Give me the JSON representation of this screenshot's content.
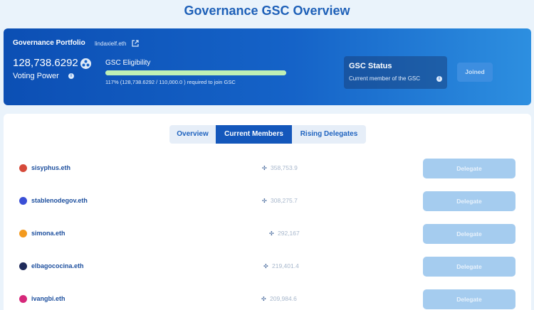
{
  "page": {
    "title": "Governance GSC Overview"
  },
  "portfolio": {
    "title": "Governance Portfolio",
    "ens": "lindaxielf.eth",
    "voting_power_value": "128,738.6292",
    "voting_power_label": "Voting Power",
    "eligibility_label": "GSC Eligibility",
    "eligibility_progress": 1.0,
    "eligibility_text": "117% (128,738.6292 / 110,000.0 ) required to join GSC",
    "status_title": "GSC Status",
    "status_text": "Current member of the GSC",
    "joined_label": "Joined"
  },
  "tabs": [
    {
      "label": "Overview"
    },
    {
      "label": "Current Members"
    },
    {
      "label": "Rising Delegates"
    }
  ],
  "members": [
    {
      "ens": "sisyphus.eth",
      "power": "358,753.9",
      "delegate_label": "Delegate",
      "avatar_color": "#d64a3a"
    },
    {
      "ens": "stablenodegov.eth",
      "power": "308,275.7",
      "delegate_label": "Delegate",
      "avatar_color": "#3a4fd6"
    },
    {
      "ens": "simona.eth",
      "power": "292,167",
      "delegate_label": "Delegate",
      "avatar_color": "#f39a1e"
    },
    {
      "ens": "elbagococina.eth",
      "power": "219,401.4",
      "delegate_label": "Delegate",
      "avatar_color": "#1e2a5a"
    },
    {
      "ens": "ivangbi.eth",
      "power": "209,984.6",
      "delegate_label": "Delegate",
      "avatar_color": "#d6287a"
    }
  ],
  "icons": {
    "ens_link": "external-link-icon",
    "voting_power": "element-logo-icon",
    "info": "info-icon",
    "power": "element-logo-icon"
  }
}
